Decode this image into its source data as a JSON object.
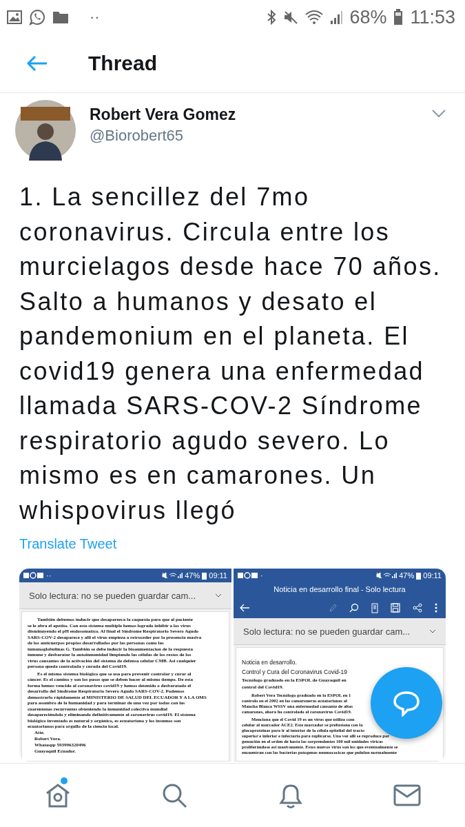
{
  "status_bar": {
    "dots": "··",
    "battery": "68%",
    "time": "11:53"
  },
  "header": {
    "title": "Thread"
  },
  "tweet": {
    "name": "Robert Vera Gomez",
    "handle": "@Biorobert65",
    "text": "1. La sencillez del 7mo coronavirus. Circula entre los murcielagos desde hace 70 años. Salto a humanos y desato el pandemonium en el planeta. El covid19 genera una enfermedad llamada SARS-COV-2 Síndrome respiratorio agudo severo. Lo mismo es en camarones. Un whispovirus llegó",
    "translate": "Translate Tweet"
  },
  "attachments": [
    {
      "status_bar": {
        "dots": "··",
        "battery": "47%",
        "time": "09:11"
      },
      "notice": "Solo lectura: no se pueden guardar cam...",
      "lines": [
        {
          "kind": "indent",
          "text": "También debemos inducir que desaparezca la caquexia para que al paciente"
        },
        {
          "kind": "body",
          "text": "se le abra el apetito. Con este sistema multiple hemos logrado inhibir a los virus"
        },
        {
          "kind": "body",
          "text": "disminuyendo el pH endosomatico. Al final el Síndrome Respiratorio Severo Agudo"
        },
        {
          "kind": "body",
          "text": "SARS-COV-2 desaparece y alli el virus empieza a retroceder por la presencia masiva"
        },
        {
          "kind": "body",
          "text": "de los anticuerpos propios desarrollados por las personas como las"
        },
        {
          "kind": "body",
          "text": "inmunoglobulinas G. También se debe inducir la bioaumentacion de la respuesta"
        },
        {
          "kind": "body",
          "text": "inmune y desbaratar la autoinmunidad limpiando las células de los restos de  los"
        },
        {
          "kind": "body",
          "text": "virus causantes de la activación del sistema de defensa celular CMB. Asi cualquier"
        },
        {
          "kind": "body",
          "text": "persona queda controlada y curada del Covid19."
        },
        {
          "kind": "indent",
          "text": "Es el mismo sistema biológico que se usa para prevenir  controlar y curar al"
        },
        {
          "kind": "body",
          "text": "cáncer. Es el camino y son los pasos que se deben hacer al mismo tiempo. De esta"
        },
        {
          "kind": "body",
          "text": "forma hemos vencido al coronavirus covid19  y hemos  detenido o desbaratado el"
        },
        {
          "kind": "body",
          "text": "desarrollo del Síndrome Respiratorio Severo Agudo SARS-COV-2.  Podemos"
        },
        {
          "kind": "body",
          "text": "demostrarlo rápidamente al MINISTERIO DE SALUD DEL ECUADOR Y A LA OMS"
        },
        {
          "kind": "body",
          "text": "para asombro de la humanidad y para terminar de una vez por todas con las"
        },
        {
          "kind": "body",
          "text": "cuarentenas recurrentes obteniendo la inmunidad colectiva mundial"
        },
        {
          "kind": "body",
          "text": "desapareciéndolo y eliminando definitivamente al coronavirus covid19. El sistema"
        },
        {
          "kind": "body",
          "text": "biológico inventado es natural y orgánico, es ecuatoriano y  los insumos son"
        },
        {
          "kind": "body",
          "text": "ecuatorianos para orgullo de la ciencia local."
        },
        {
          "kind": "sign",
          "text": "Atte."
        },
        {
          "kind": "sign",
          "text": "Robert Vera."
        },
        {
          "kind": "sign",
          "text": "Whataspp 593996320496"
        },
        {
          "kind": "sign",
          "text": "Guayaquil Ecuador."
        }
      ]
    },
    {
      "status_bar": {
        "dots": "·",
        "battery": "47%",
        "time": "09:11"
      },
      "title": "Noticia en desarrollo final - Solo lectura",
      "toolbar": true,
      "notice": "Solo lectura: no se pueden guardar cam...",
      "lines": [
        {
          "kind": "heading",
          "text": "Noticia en desarrollo."
        },
        {
          "kind": "heading",
          "text": "Control y Cura del Coronavirus Covid-19"
        },
        {
          "kind": "subheading",
          "text": "Tecnólogo graduado en la ESPOL de Guayaquil en"
        },
        {
          "kind": "subheading",
          "text": "control del Covid19."
        },
        {
          "kind": "indent",
          "text": "Robert Vera Tecnólogo graduado en la ESPOL en 1"
        },
        {
          "kind": "body",
          "text": "controlo en el 2002 en las camaroneras ecuatorianas al"
        },
        {
          "kind": "body",
          "text": "Mancha Blanca WSSV una enfermedad causante de altas"
        },
        {
          "kind": "body",
          "text": "camarones, ahora ha controlado al coronavirus Covid19."
        },
        {
          "kind": "indent",
          "text": "Menciona que el Covid 19 es un virus que utiliza com"
        },
        {
          "kind": "body",
          "text": "celular al marcador ACE2. Este marcador se prefusiona con la"
        },
        {
          "kind": "body",
          "text": "glucoproteinas para ir al interior de la célula epitelial del tracto"
        },
        {
          "kind": "body",
          "text": "superior e inferior e infectaria para replicarse. Una vez alli se reproduce por"
        },
        {
          "kind": "body",
          "text": "gemación en el orden de hasta las sorprendentes 100 mil unidades viricas"
        },
        {
          "kind": "body",
          "text": "proliferándose asi masivamente. Estos nuevos virus son los que eventualmente se"
        },
        {
          "kind": "body",
          "text": "encuentran con las bacterias patogenas neumococicas que pululan normalmente"
        }
      ]
    }
  ],
  "nav": [
    {
      "kind": "home",
      "dot": true
    },
    {
      "kind": "search",
      "dot": false
    },
    {
      "kind": "notifications",
      "dot": false
    },
    {
      "kind": "messages",
      "dot": false
    }
  ]
}
